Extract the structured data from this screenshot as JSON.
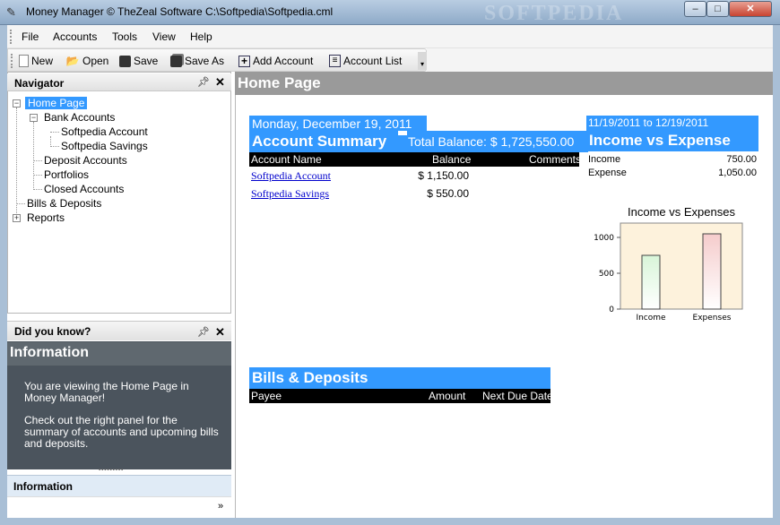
{
  "window": {
    "title": "Money Manager © TheZeal Software C:\\Softpedia\\Softpedia.cml",
    "watermark": "SOFTPEDIA",
    "minimize": "‒",
    "maximize": "□",
    "close": "✕"
  },
  "menu": {
    "items": [
      "File",
      "Accounts",
      "Tools",
      "View",
      "Help"
    ]
  },
  "toolbar": {
    "buttons": [
      {
        "label": "New",
        "icon": "new-document-icon"
      },
      {
        "label": "Open",
        "icon": "open-folder-icon"
      },
      {
        "label": "Save",
        "icon": "save-disk-icon"
      },
      {
        "label": "Save As",
        "icon": "save-as-disk-icon"
      },
      {
        "label": "Add Account",
        "icon": "add-plus-icon"
      },
      {
        "label": "Account List",
        "icon": "list-icon"
      }
    ]
  },
  "navigator": {
    "title": "Navigator",
    "tree": {
      "home": "Home Page",
      "bank_accounts": "Bank Accounts",
      "acct1": "Softpedia Account",
      "acct2": "Softpedia Savings",
      "deposit_accounts": "Deposit Accounts",
      "portfolios": "Portfolios",
      "closed_accounts": "Closed Accounts",
      "bills_deposits": "Bills & Deposits",
      "reports": "Reports"
    }
  },
  "did_you_know": {
    "title": "Did you know?",
    "info_heading": "Information",
    "body1": "You are viewing the Home Page in Money Manager!",
    "body2": "Check out the right panel for the summary of accounts and upcoming bills and deposits.",
    "tab_label": "Information"
  },
  "main": {
    "header": "Home Page",
    "date": "Monday, December 19, 2011",
    "account_summary_title": "Account Summary",
    "total_balance": "Total Balance: $ 1,725,550.00",
    "columns": {
      "name": "Account Name",
      "balance": "Balance",
      "comments": "Comments"
    },
    "accounts": [
      {
        "name": "Softpedia Account",
        "balance": "$ 1,150.00"
      },
      {
        "name": "Softpedia Savings",
        "balance": "$ 550.00"
      }
    ],
    "range": "11/19/2011 to 12/19/2011",
    "ive_title": "Income vs Expense",
    "income_label": "Income",
    "income_value": "750.00",
    "expense_label": "Expense",
    "expense_value": "1,050.00",
    "bills_title": "Bills & Deposits",
    "bills_columns": {
      "payee": "Payee",
      "amount": "Amount",
      "next_due": "Next Due Date"
    }
  },
  "chart_data": {
    "type": "bar",
    "title": "Income vs Expenses",
    "categories": [
      "Income",
      "Expenses"
    ],
    "values": [
      750,
      1050
    ],
    "ylim": [
      0,
      1200
    ],
    "yticks": [
      0,
      500,
      1000
    ],
    "colors": [
      "#d8f5d8",
      "#f5cccc"
    ],
    "background": "#fdf2dc"
  }
}
